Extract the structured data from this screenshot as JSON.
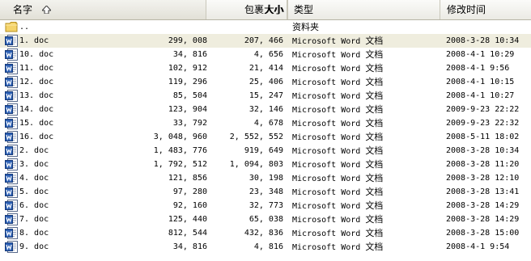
{
  "header": {
    "name": "名字",
    "size": "大小",
    "packed": "包裹大小",
    "type": "类型",
    "mtime": "修改时间"
  },
  "parent_row": {
    "name": "..",
    "type": "资料夹"
  },
  "rows": [
    {
      "name": "1. doc",
      "size": "299, 008",
      "packed": "207, 466",
      "type_prefix": "Microsoft Word ",
      "type_suffix": "文档",
      "mtime": "2008-3-28 10:34",
      "selected": true
    },
    {
      "name": "10. doc",
      "size": "34, 816",
      "packed": "4, 656",
      "type_prefix": "Microsoft Word ",
      "type_suffix": "文档",
      "mtime": "2008-4-1 10:29"
    },
    {
      "name": "11. doc",
      "size": "102, 912",
      "packed": "21, 414",
      "type_prefix": "Microsoft Word ",
      "type_suffix": "文档",
      "mtime": "2008-4-1 9:56"
    },
    {
      "name": "12. doc",
      "size": "119, 296",
      "packed": "25, 406",
      "type_prefix": "Microsoft Word ",
      "type_suffix": "文档",
      "mtime": "2008-4-1 10:15"
    },
    {
      "name": "13. doc",
      "size": "85, 504",
      "packed": "15, 247",
      "type_prefix": "Microsoft Word ",
      "type_suffix": "文档",
      "mtime": "2008-4-1 10:27"
    },
    {
      "name": "14. doc",
      "size": "123, 904",
      "packed": "32, 146",
      "type_prefix": "Microsoft Word ",
      "type_suffix": "文档",
      "mtime": "2009-9-23 22:22"
    },
    {
      "name": "15. doc",
      "size": "33, 792",
      "packed": "4, 678",
      "type_prefix": "Microsoft Word ",
      "type_suffix": "文档",
      "mtime": "2009-9-23 22:32"
    },
    {
      "name": "16. doc",
      "size": "3, 048, 960",
      "packed": "2, 552, 552",
      "type_prefix": "Microsoft Word ",
      "type_suffix": "文档",
      "mtime": "2008-5-11 18:02"
    },
    {
      "name": "2. doc",
      "size": "1, 483, 776",
      "packed": "919, 649",
      "type_prefix": "Microsoft Word ",
      "type_suffix": "文档",
      "mtime": "2008-3-28 10:34"
    },
    {
      "name": "3. doc",
      "size": "1, 792, 512",
      "packed": "1, 094, 803",
      "type_prefix": "Microsoft Word ",
      "type_suffix": "文档",
      "mtime": "2008-3-28 11:20"
    },
    {
      "name": "4. doc",
      "size": "121, 856",
      "packed": "30, 198",
      "type_prefix": "Microsoft Word ",
      "type_suffix": "文档",
      "mtime": "2008-3-28 12:10"
    },
    {
      "name": "5. doc",
      "size": "97, 280",
      "packed": "23, 348",
      "type_prefix": "Microsoft Word ",
      "type_suffix": "文档",
      "mtime": "2008-3-28 13:41"
    },
    {
      "name": "6. doc",
      "size": "92, 160",
      "packed": "32, 773",
      "type_prefix": "Microsoft Word ",
      "type_suffix": "文档",
      "mtime": "2008-3-28 14:29"
    },
    {
      "name": "7. doc",
      "size": "125, 440",
      "packed": "65, 038",
      "type_prefix": "Microsoft Word ",
      "type_suffix": "文档",
      "mtime": "2008-3-28 14:29"
    },
    {
      "name": "8. doc",
      "size": "812, 544",
      "packed": "432, 836",
      "type_prefix": "Microsoft Word ",
      "type_suffix": "文档",
      "mtime": "2008-3-28 15:00"
    },
    {
      "name": "9. doc",
      "size": "34, 816",
      "packed": "4, 816",
      "type_prefix": "Microsoft Word ",
      "type_suffix": "文档",
      "mtime": "2008-4-1 9:54"
    }
  ],
  "icons": {
    "folder": "folder-icon",
    "doc": "word-doc-icon",
    "sort": "sort-ascending-icon"
  },
  "colors": {
    "selected_row": "#efedde",
    "header_bg": "#ebeae4",
    "word_icon_blue": "#2b5fb4"
  }
}
